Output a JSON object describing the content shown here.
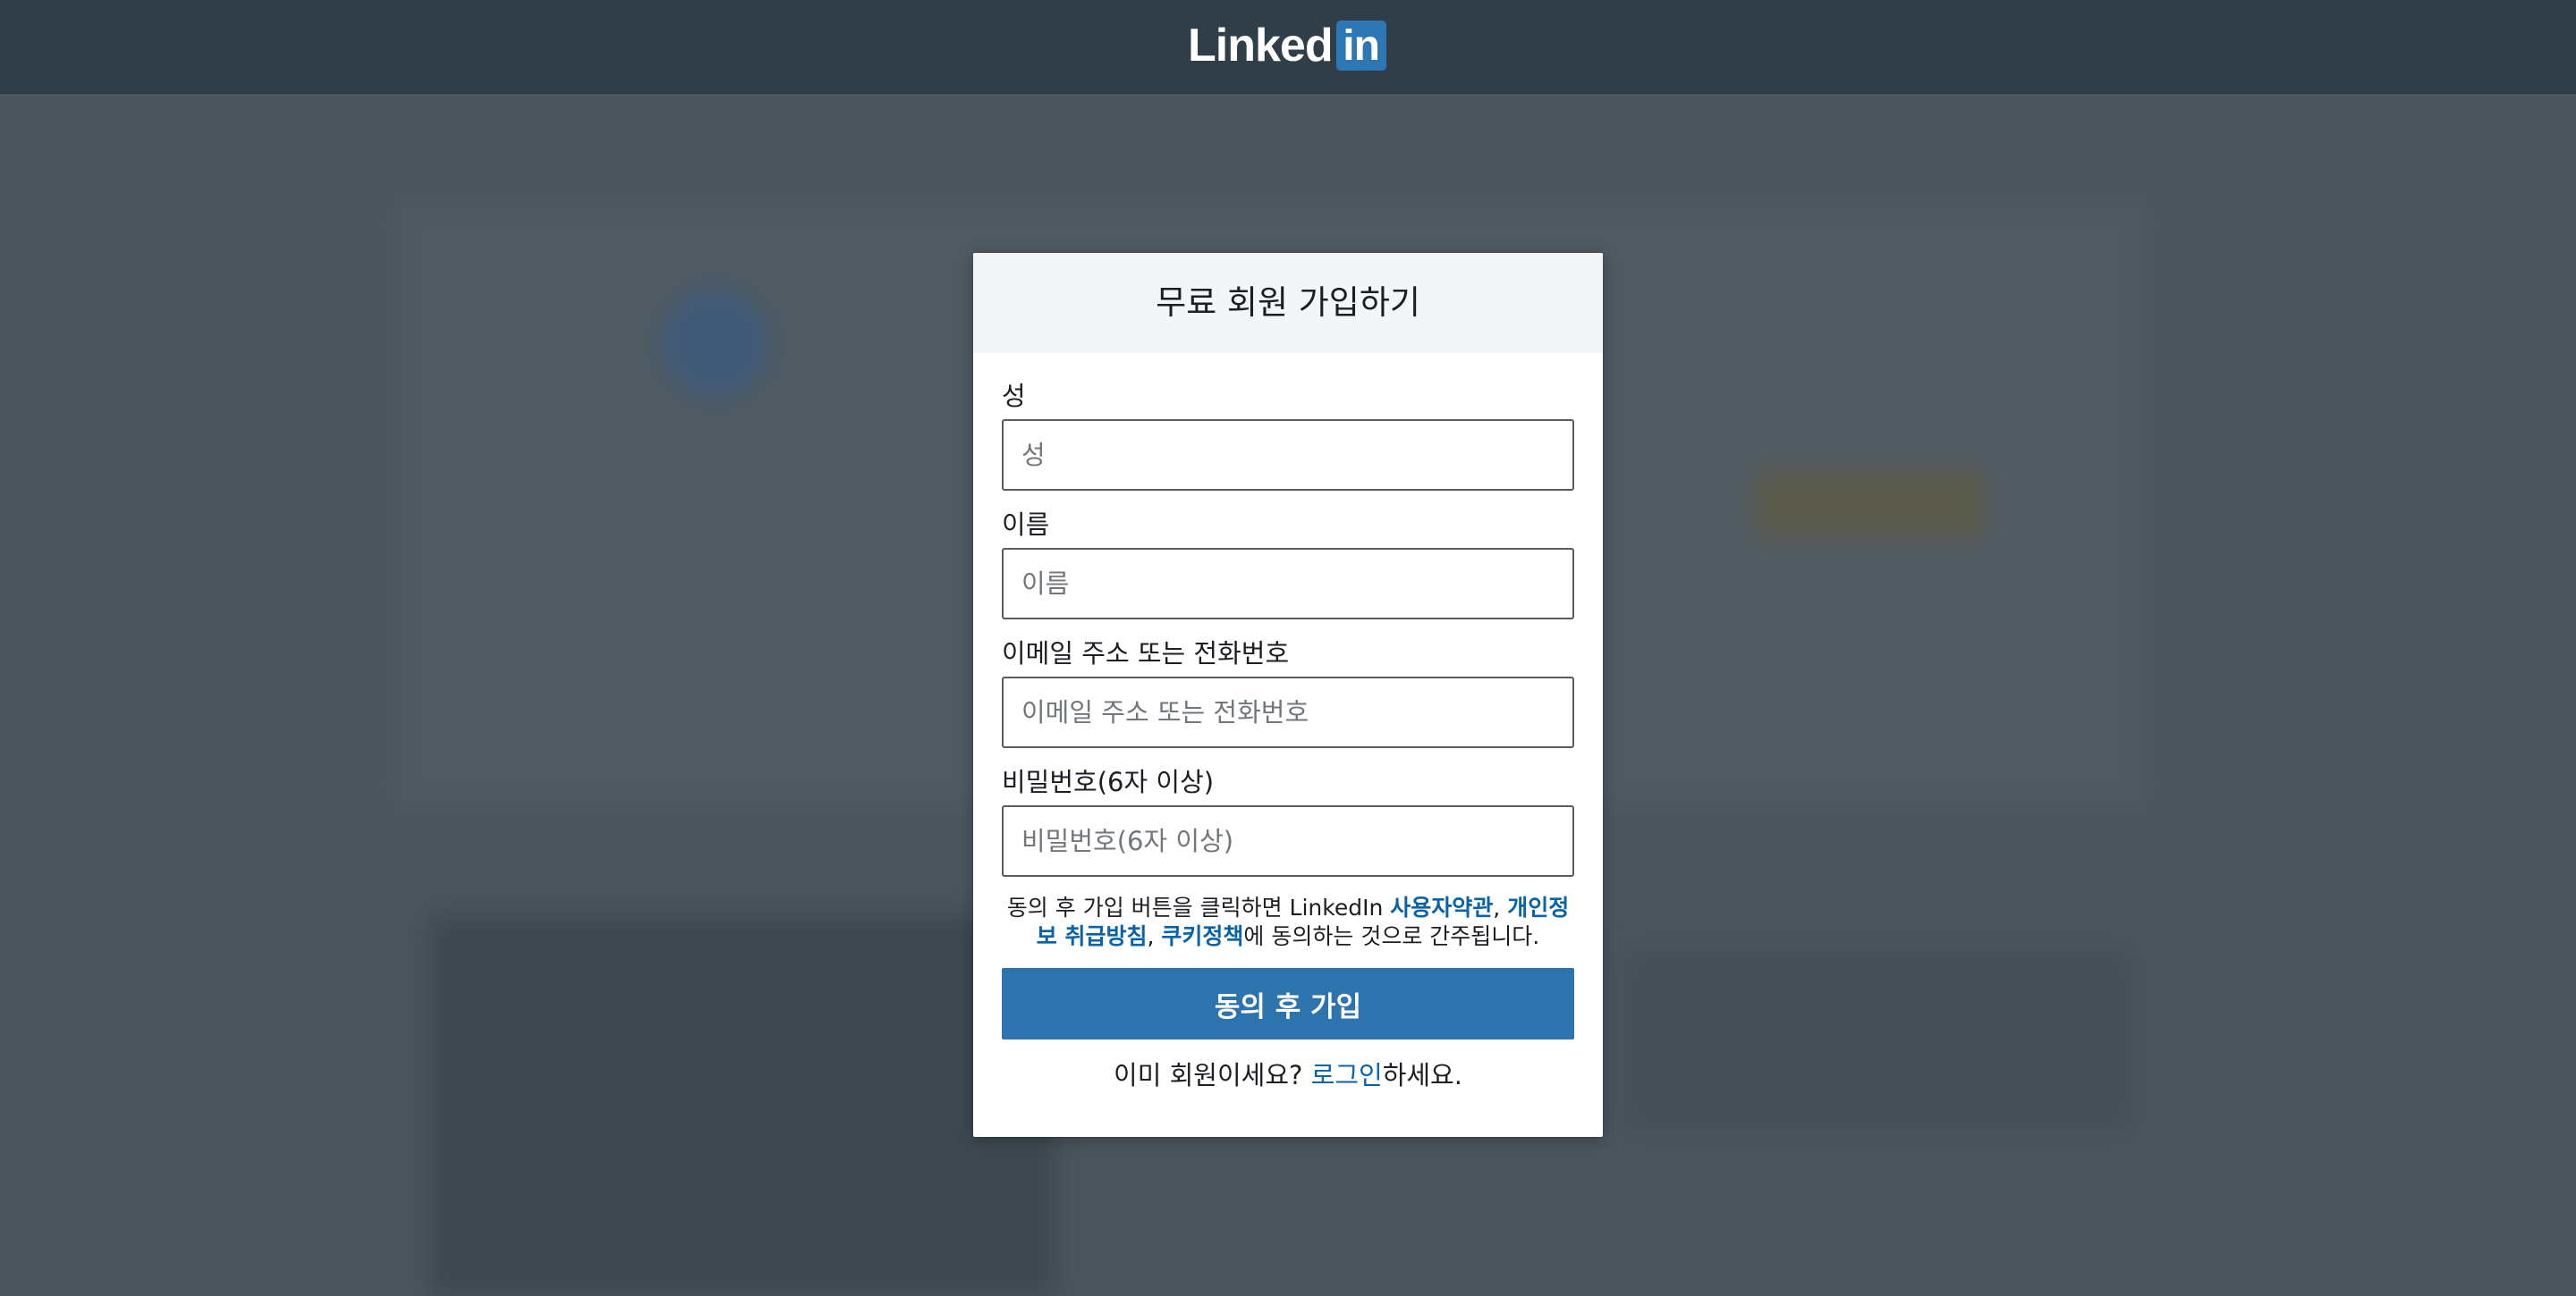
{
  "header": {
    "logo_word": "Linked",
    "logo_box": "in"
  },
  "modal": {
    "title": "무료 회원 가입하기",
    "fields": [
      {
        "label": "성",
        "placeholder": "성"
      },
      {
        "label": "이름",
        "placeholder": "이름"
      },
      {
        "label": "이메일 주소 또는 전화번호",
        "placeholder": "이메일 주소 또는 전화번호"
      },
      {
        "label": "비밀번호(6자 이상)",
        "placeholder": "비밀번호(6자 이상)"
      }
    ],
    "terms": {
      "prefix": "동의 후 가입 버튼을 클릭하면 LinkedIn ",
      "user_agreement": "사용자약관",
      "sep1": ", ",
      "privacy_policy": "개인정보 취급방침",
      "sep2": ", ",
      "cookie_policy": "쿠키정책",
      "suffix": "에 동의하는 것으로 간주됩니다."
    },
    "submit_label": "동의 후 가입",
    "login": {
      "prefix": "이미 회원이세요? ",
      "link": "로그인",
      "suffix": "하세요."
    }
  },
  "colors": {
    "header_bg": "#2f3e48",
    "overlay_bg": "#4b555e",
    "brand_blue": "#2d73ad",
    "link_blue": "#0a63a8"
  }
}
